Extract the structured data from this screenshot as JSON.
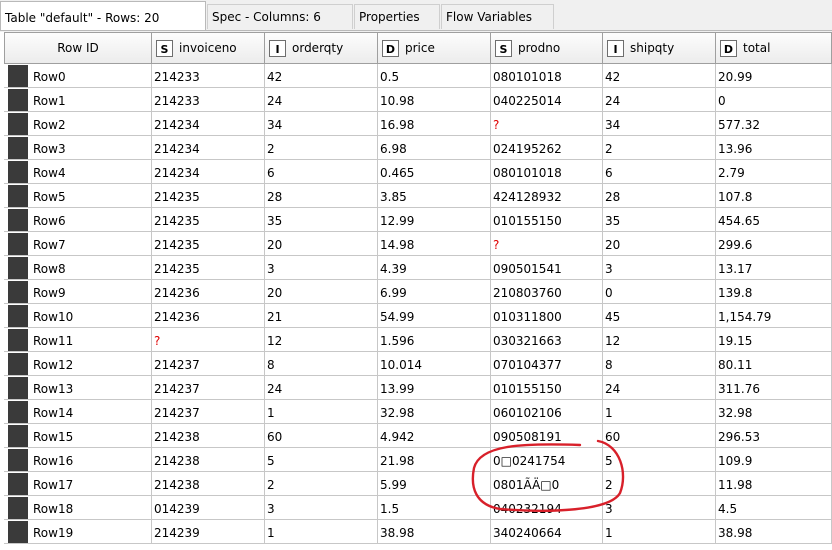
{
  "tabs": [
    {
      "label": "Table \"default\" - Rows: 20",
      "active": true
    },
    {
      "label": "Spec - Columns: 6",
      "active": false
    },
    {
      "label": "Properties",
      "active": false
    },
    {
      "label": "Flow Variables",
      "active": false
    }
  ],
  "table": {
    "rowid_header": "Row ID",
    "columns": [
      {
        "type": "S",
        "name": "invoiceno"
      },
      {
        "type": "I",
        "name": "orderqty"
      },
      {
        "type": "D",
        "name": "price"
      },
      {
        "type": "S",
        "name": "prodno"
      },
      {
        "type": "I",
        "name": "shipqty"
      },
      {
        "type": "D",
        "name": "total"
      }
    ],
    "rows": [
      {
        "id": "Row0",
        "cells": [
          "214233",
          "42",
          "0.5",
          "080101018",
          "42",
          "20.99"
        ]
      },
      {
        "id": "Row1",
        "cells": [
          "214233",
          "24",
          "10.98",
          "040225014",
          "24",
          "0"
        ]
      },
      {
        "id": "Row2",
        "cells": [
          "214234",
          "34",
          "16.98",
          "?",
          "34",
          "577.32"
        ]
      },
      {
        "id": "Row3",
        "cells": [
          "214234",
          "2",
          "6.98",
          "024195262",
          "2",
          "13.96"
        ]
      },
      {
        "id": "Row4",
        "cells": [
          "214234",
          "6",
          "0.465",
          "080101018",
          "6",
          "2.79"
        ]
      },
      {
        "id": "Row5",
        "cells": [
          "214235",
          "28",
          "3.85",
          "424128932",
          "28",
          "107.8"
        ]
      },
      {
        "id": "Row6",
        "cells": [
          "214235",
          "35",
          "12.99",
          "010155150",
          "35",
          "454.65"
        ]
      },
      {
        "id": "Row7",
        "cells": [
          "214235",
          "20",
          "14.98",
          "?",
          "20",
          "299.6"
        ]
      },
      {
        "id": "Row8",
        "cells": [
          "214235",
          "3",
          "4.39",
          "090501541",
          "3",
          "13.17"
        ]
      },
      {
        "id": "Row9",
        "cells": [
          "214236",
          "20",
          "6.99",
          "210803760",
          "0",
          "139.8"
        ]
      },
      {
        "id": "Row10",
        "cells": [
          "214236",
          "21",
          "54.99",
          "010311800",
          "45",
          "1,154.79"
        ]
      },
      {
        "id": "Row11",
        "cells": [
          "?",
          "12",
          "1.596",
          "030321663",
          "12",
          "19.15"
        ]
      },
      {
        "id": "Row12",
        "cells": [
          "214237",
          "8",
          "10.014",
          "070104377",
          "8",
          "80.11"
        ]
      },
      {
        "id": "Row13",
        "cells": [
          "214237",
          "24",
          "13.99",
          "010155150",
          "24",
          "311.76"
        ]
      },
      {
        "id": "Row14",
        "cells": [
          "214237",
          "1",
          "32.98",
          "060102106",
          "1",
          "32.98"
        ]
      },
      {
        "id": "Row15",
        "cells": [
          "214238",
          "60",
          "4.942",
          "090508191",
          "60",
          "296.53"
        ]
      },
      {
        "id": "Row16",
        "cells": [
          "214238",
          "5",
          "21.98",
          "0□0241754",
          "5",
          "109.9"
        ]
      },
      {
        "id": "Row17",
        "cells": [
          "214238",
          "2",
          "5.99",
          "0801ÃÄ□0",
          "2",
          "11.98"
        ]
      },
      {
        "id": "Row18",
        "cells": [
          "014239",
          "3",
          "1.5",
          "040232194",
          "3",
          "4.5"
        ]
      },
      {
        "id": "Row19",
        "cells": [
          "214239",
          "1",
          "38.98",
          "340240664",
          "1",
          "38.98"
        ]
      }
    ]
  },
  "colors": {
    "missing": "#e00000",
    "annotation": "#d8202a",
    "row_marker": "#3a3a3a"
  }
}
